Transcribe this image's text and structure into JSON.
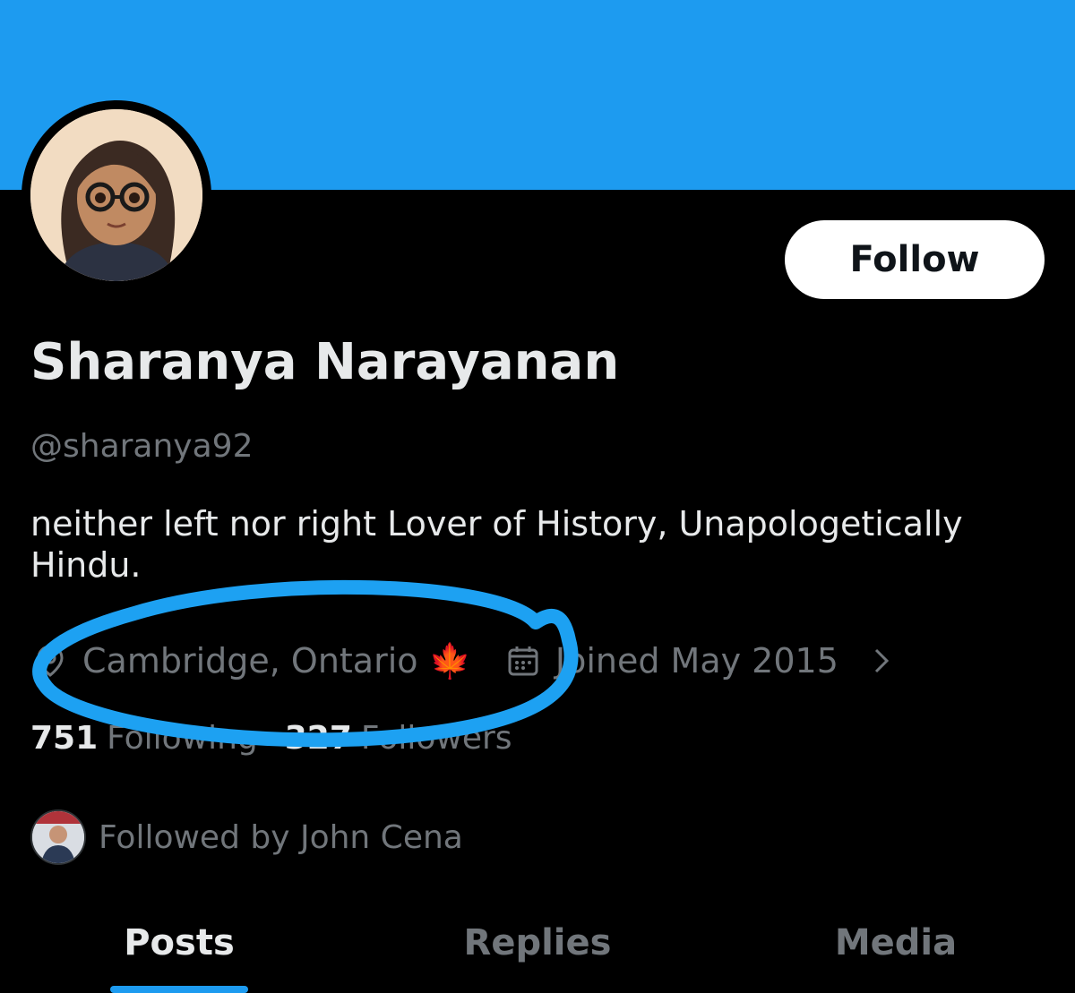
{
  "profile": {
    "display_name": "Sharanya Narayanan",
    "handle": "@sharanya92",
    "bio": "neither left nor right Lover of History, Unapologetically Hindu.",
    "location": "Cambridge, Ontario",
    "location_emoji": "🍁",
    "joined": "Joined May 2015",
    "avatar_icon": "cartoon-avatar-glasses"
  },
  "actions": {
    "follow_label": "Follow"
  },
  "stats": {
    "following_count": "751",
    "following_label": "Following",
    "followers_count": "327",
    "followers_label": "Followers"
  },
  "followed_by": {
    "text": "Followed by John Cena"
  },
  "tabs": [
    {
      "label": "Posts",
      "active": true
    },
    {
      "label": "Replies",
      "active": false
    },
    {
      "label": "Media",
      "active": false
    }
  ],
  "colors": {
    "banner": "#1d9bf0",
    "background": "#000000",
    "secondary_text": "#71767b",
    "annotation": "#1da1f2"
  }
}
